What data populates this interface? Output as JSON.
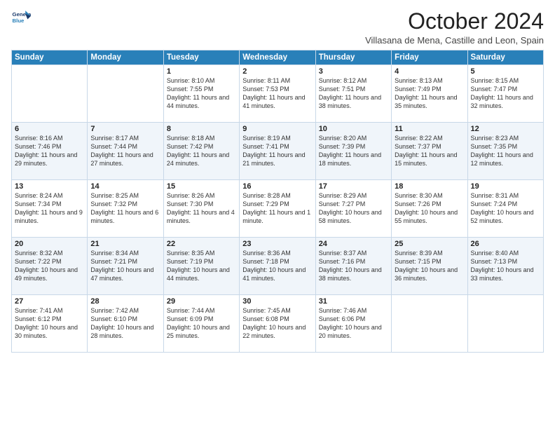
{
  "header": {
    "logo_line1": "General",
    "logo_line2": "Blue",
    "month_title": "October 2024",
    "location": "Villasana de Mena, Castille and Leon, Spain"
  },
  "days_of_week": [
    "Sunday",
    "Monday",
    "Tuesday",
    "Wednesday",
    "Thursday",
    "Friday",
    "Saturday"
  ],
  "weeks": [
    [
      {
        "day": "",
        "content": ""
      },
      {
        "day": "",
        "content": ""
      },
      {
        "day": "1",
        "content": "Sunrise: 8:10 AM\nSunset: 7:55 PM\nDaylight: 11 hours and 44 minutes."
      },
      {
        "day": "2",
        "content": "Sunrise: 8:11 AM\nSunset: 7:53 PM\nDaylight: 11 hours and 41 minutes."
      },
      {
        "day": "3",
        "content": "Sunrise: 8:12 AM\nSunset: 7:51 PM\nDaylight: 11 hours and 38 minutes."
      },
      {
        "day": "4",
        "content": "Sunrise: 8:13 AM\nSunset: 7:49 PM\nDaylight: 11 hours and 35 minutes."
      },
      {
        "day": "5",
        "content": "Sunrise: 8:15 AM\nSunset: 7:47 PM\nDaylight: 11 hours and 32 minutes."
      }
    ],
    [
      {
        "day": "6",
        "content": "Sunrise: 8:16 AM\nSunset: 7:46 PM\nDaylight: 11 hours and 29 minutes."
      },
      {
        "day": "7",
        "content": "Sunrise: 8:17 AM\nSunset: 7:44 PM\nDaylight: 11 hours and 27 minutes."
      },
      {
        "day": "8",
        "content": "Sunrise: 8:18 AM\nSunset: 7:42 PM\nDaylight: 11 hours and 24 minutes."
      },
      {
        "day": "9",
        "content": "Sunrise: 8:19 AM\nSunset: 7:41 PM\nDaylight: 11 hours and 21 minutes."
      },
      {
        "day": "10",
        "content": "Sunrise: 8:20 AM\nSunset: 7:39 PM\nDaylight: 11 hours and 18 minutes."
      },
      {
        "day": "11",
        "content": "Sunrise: 8:22 AM\nSunset: 7:37 PM\nDaylight: 11 hours and 15 minutes."
      },
      {
        "day": "12",
        "content": "Sunrise: 8:23 AM\nSunset: 7:35 PM\nDaylight: 11 hours and 12 minutes."
      }
    ],
    [
      {
        "day": "13",
        "content": "Sunrise: 8:24 AM\nSunset: 7:34 PM\nDaylight: 11 hours and 9 minutes."
      },
      {
        "day": "14",
        "content": "Sunrise: 8:25 AM\nSunset: 7:32 PM\nDaylight: 11 hours and 6 minutes."
      },
      {
        "day": "15",
        "content": "Sunrise: 8:26 AM\nSunset: 7:30 PM\nDaylight: 11 hours and 4 minutes."
      },
      {
        "day": "16",
        "content": "Sunrise: 8:28 AM\nSunset: 7:29 PM\nDaylight: 11 hours and 1 minute."
      },
      {
        "day": "17",
        "content": "Sunrise: 8:29 AM\nSunset: 7:27 PM\nDaylight: 10 hours and 58 minutes."
      },
      {
        "day": "18",
        "content": "Sunrise: 8:30 AM\nSunset: 7:26 PM\nDaylight: 10 hours and 55 minutes."
      },
      {
        "day": "19",
        "content": "Sunrise: 8:31 AM\nSunset: 7:24 PM\nDaylight: 10 hours and 52 minutes."
      }
    ],
    [
      {
        "day": "20",
        "content": "Sunrise: 8:32 AM\nSunset: 7:22 PM\nDaylight: 10 hours and 49 minutes."
      },
      {
        "day": "21",
        "content": "Sunrise: 8:34 AM\nSunset: 7:21 PM\nDaylight: 10 hours and 47 minutes."
      },
      {
        "day": "22",
        "content": "Sunrise: 8:35 AM\nSunset: 7:19 PM\nDaylight: 10 hours and 44 minutes."
      },
      {
        "day": "23",
        "content": "Sunrise: 8:36 AM\nSunset: 7:18 PM\nDaylight: 10 hours and 41 minutes."
      },
      {
        "day": "24",
        "content": "Sunrise: 8:37 AM\nSunset: 7:16 PM\nDaylight: 10 hours and 38 minutes."
      },
      {
        "day": "25",
        "content": "Sunrise: 8:39 AM\nSunset: 7:15 PM\nDaylight: 10 hours and 36 minutes."
      },
      {
        "day": "26",
        "content": "Sunrise: 8:40 AM\nSunset: 7:13 PM\nDaylight: 10 hours and 33 minutes."
      }
    ],
    [
      {
        "day": "27",
        "content": "Sunrise: 7:41 AM\nSunset: 6:12 PM\nDaylight: 10 hours and 30 minutes."
      },
      {
        "day": "28",
        "content": "Sunrise: 7:42 AM\nSunset: 6:10 PM\nDaylight: 10 hours and 28 minutes."
      },
      {
        "day": "29",
        "content": "Sunrise: 7:44 AM\nSunset: 6:09 PM\nDaylight: 10 hours and 25 minutes."
      },
      {
        "day": "30",
        "content": "Sunrise: 7:45 AM\nSunset: 6:08 PM\nDaylight: 10 hours and 22 minutes."
      },
      {
        "day": "31",
        "content": "Sunrise: 7:46 AM\nSunset: 6:06 PM\nDaylight: 10 hours and 20 minutes."
      },
      {
        "day": "",
        "content": ""
      },
      {
        "day": "",
        "content": ""
      }
    ]
  ]
}
